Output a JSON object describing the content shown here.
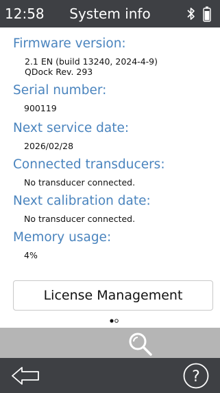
{
  "statusbar": {
    "time": "12:58",
    "title": "System info",
    "bluetooth_icon": "bluetooth-icon",
    "battery_icon": "battery-icon"
  },
  "info": {
    "firmware": {
      "label": "Firmware version:",
      "line1": "2.1 EN (build 13240, 2024-4-9)",
      "line2": "QDock Rev. 293"
    },
    "serial": {
      "label": "Serial number:",
      "value": "900119"
    },
    "service": {
      "label": "Next service date:",
      "value": "2026/02/28"
    },
    "transducers": {
      "label": "Connected transducers:",
      "value": "No transducer connected."
    },
    "calibration": {
      "label": "Next calibration date:",
      "value": "No transducer connected."
    },
    "memory": {
      "label": "Memory usage:",
      "value": "4%"
    }
  },
  "license_button": {
    "label": "License Management"
  },
  "pagination": {
    "current": 1,
    "total": 2
  },
  "search_bar": {
    "icon": "search-icon"
  },
  "navbar": {
    "back_icon": "back-arrow-icon",
    "help_icon": "help-icon"
  },
  "colors": {
    "bar": "#3e4044",
    "heading": "#4a84be",
    "search_bar": "#b5b5b5"
  }
}
